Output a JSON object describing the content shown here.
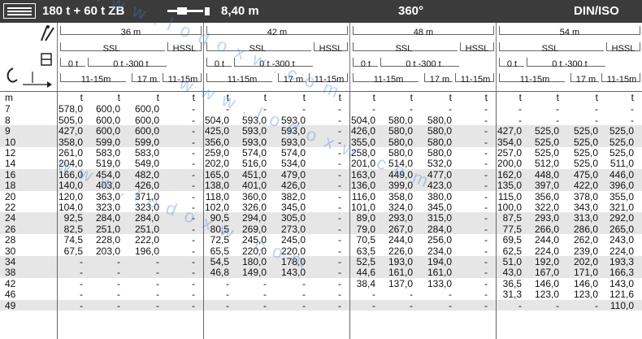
{
  "header": {
    "load_title": "180 t + 60 t ZB",
    "boom_length": "8,40 m",
    "slew": "360°",
    "standard": "DIN/ISO"
  },
  "groups": [
    {
      "length": "36 m",
      "ssl": "SSL",
      "hssl": "HSSL",
      "ssl_range": "0 t",
      "ssl_range2": "0 t -300 t",
      "sub1": "11-15m",
      "sub2": "17 m",
      "sub3": "11-15m"
    },
    {
      "length": "42 m",
      "ssl": "SSL",
      "hssl": "HSSL",
      "ssl_range": "0 t",
      "ssl_range2": "0 t -300 t",
      "sub1": "11-15m",
      "sub2": "17 m",
      "sub3": "11-15m"
    },
    {
      "length": "48 m",
      "ssl": "SSL",
      "hssl": "HSSL",
      "ssl_range": "0 t",
      "ssl_range2": "0 t -300 t",
      "sub1": "11-15m",
      "sub2": "17 m",
      "sub3": "11-15m"
    },
    {
      "length": "54 m",
      "ssl": "SSL",
      "hssl": "HSSL",
      "ssl_range": "0 t",
      "ssl_range2": "0 t -300 t",
      "sub1": "11-15m",
      "sub2": "17 m",
      "sub3": "11-15m"
    }
  ],
  "units": {
    "radius": "m",
    "load": "t"
  },
  "rows": [
    {
      "r": "7",
      "v": [
        "578,0",
        "600,0",
        "600,0",
        "-",
        "-",
        "-",
        "-",
        "-",
        "-",
        "-",
        "-",
        "-",
        "-",
        "-",
        "-",
        "-"
      ]
    },
    {
      "r": "8",
      "v": [
        "505,0",
        "600,0",
        "600,0",
        "-",
        "504,0",
        "593,0",
        "593,0",
        "-",
        "504,0",
        "580,0",
        "580,0",
        "-",
        "-",
        "-",
        "-",
        "-"
      ]
    },
    {
      "r": "9",
      "v": [
        "427,0",
        "600,0",
        "600,0",
        "-",
        "425,0",
        "593,0",
        "593,0",
        "-",
        "426,0",
        "580,0",
        "580,0",
        "-",
        "427,0",
        "525,0",
        "525,0",
        "525,0"
      ]
    },
    {
      "r": "10",
      "v": [
        "358,0",
        "599,0",
        "599,0",
        "-",
        "356,0",
        "593,0",
        "593,0",
        "-",
        "355,0",
        "580,0",
        "580,0",
        "-",
        "354,0",
        "525,0",
        "525,0",
        "525,0"
      ]
    },
    {
      "r": "12",
      "v": [
        "261,0",
        "583,0",
        "583,0",
        "-",
        "259,0",
        "574,0",
        "574,0",
        "-",
        "258,0",
        "580,0",
        "580,0",
        "-",
        "257,0",
        "525,0",
        "525,0",
        "525,0"
      ]
    },
    {
      "r": "14",
      "v": [
        "204,0",
        "519,0",
        "549,0",
        "-",
        "202,0",
        "516,0",
        "534,0",
        "-",
        "201,0",
        "514,0",
        "532,0",
        "-",
        "200,0",
        "512,0",
        "525,0",
        "511,0"
      ]
    },
    {
      "r": "16",
      "v": [
        "166,0",
        "454,0",
        "482,0",
        "-",
        "165,0",
        "451,0",
        "479,0",
        "-",
        "163,0",
        "449,0",
        "477,0",
        "-",
        "162,0",
        "448,0",
        "475,0",
        "446,0"
      ]
    },
    {
      "r": "18",
      "v": [
        "140,0",
        "403,0",
        "426,0",
        "-",
        "138,0",
        "401,0",
        "426,0",
        "-",
        "136,0",
        "399,0",
        "423,0",
        "-",
        "135,0",
        "397,0",
        "422,0",
        "396,0"
      ]
    },
    {
      "r": "20",
      "v": [
        "120,0",
        "363,0",
        "371,0",
        "-",
        "118,0",
        "360,0",
        "382,0",
        "-",
        "116,0",
        "358,0",
        "380,0",
        "-",
        "115,0",
        "356,0",
        "378,0",
        "355,0"
      ]
    },
    {
      "r": "22",
      "v": [
        "104,0",
        "323,0",
        "323,0",
        "-",
        "102,0",
        "326,0",
        "345,0",
        "-",
        "101,0",
        "324,0",
        "345,0",
        "-",
        "100,0",
        "322,0",
        "343,0",
        "321,0"
      ]
    },
    {
      "r": "24",
      "v": [
        "92,5",
        "284,0",
        "284,0",
        "-",
        "90,5",
        "294,0",
        "305,0",
        "-",
        "89,0",
        "293,0",
        "315,0",
        "-",
        "87,5",
        "293,0",
        "313,0",
        "292,0"
      ]
    },
    {
      "r": "26",
      "v": [
        "82,5",
        "251,0",
        "251,0",
        "-",
        "80,5",
        "269,0",
        "273,0",
        "-",
        "79,0",
        "267,0",
        "284,0",
        "-",
        "77,5",
        "266,0",
        "286,0",
        "265,0"
      ]
    },
    {
      "r": "28",
      "v": [
        "74,5",
        "228,0",
        "222,0",
        "-",
        "72,5",
        "245,0",
        "245,0",
        "-",
        "70,5",
        "244,0",
        "256,0",
        "-",
        "69,5",
        "244,0",
        "262,0",
        "243,0"
      ]
    },
    {
      "r": "30",
      "v": [
        "67,5",
        "203,0",
        "196,0",
        "-",
        "65,5",
        "220,0",
        "220,0",
        "-",
        "63,5",
        "226,0",
        "234,0",
        "-",
        "62,5",
        "224,0",
        "239,0",
        "224,0"
      ]
    },
    {
      "r": "34",
      "v": [
        "-",
        "-",
        "-",
        "-",
        "54,5",
        "180,0",
        "178,0",
        "-",
        "52,5",
        "193,0",
        "194,0",
        "-",
        "51,0",
        "192,0",
        "202,0",
        "193,3"
      ]
    },
    {
      "r": "38",
      "v": [
        "-",
        "-",
        "-",
        "-",
        "46,8",
        "149,0",
        "143,0",
        "-",
        "44,6",
        "161,0",
        "161,0",
        "-",
        "43,0",
        "167,0",
        "171,0",
        "166,3"
      ]
    },
    {
      "r": "42",
      "v": [
        "-",
        "-",
        "-",
        "-",
        "-",
        "-",
        "-",
        "-",
        "38,4",
        "137,0",
        "133,0",
        "-",
        "36,5",
        "146,0",
        "146,0",
        "143,0"
      ]
    },
    {
      "r": "46",
      "v": [
        "-",
        "-",
        "-",
        "-",
        "-",
        "-",
        "-",
        "-",
        "-",
        "-",
        "-",
        "-",
        "31,3",
        "123,0",
        "123,0",
        "121,6"
      ]
    },
    {
      "r": "49",
      "v": [
        "-",
        "-",
        "-",
        "-",
        "-",
        "-",
        "-",
        "-",
        "-",
        "-",
        "-",
        "-",
        "-",
        "-",
        "-",
        "110,0"
      ]
    }
  ],
  "watermarks": [
    "w w w . l o d o x w . c o m",
    "w w w . l o d o x w . c o m",
    "w w w . l o d o x w . c o m"
  ],
  "colors": {
    "header_bg": "#3b3b3b",
    "row_shade": "#e6e6e6",
    "watermark": "#4682d2"
  }
}
